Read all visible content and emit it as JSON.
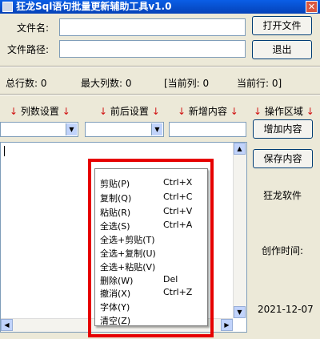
{
  "window": {
    "title": "狂龙Sql语句批量更新辅助工具v1.0",
    "close_glyph": "✕"
  },
  "file": {
    "name_label": "文件名:",
    "path_label": "文件路径:",
    "name_value": "",
    "path_value": "",
    "open_label": "打开文件",
    "exit_label": "退出"
  },
  "stats": {
    "total_rows": "总行数: 0",
    "max_cols": "最大列数: 0",
    "current_col": "[当前列: 0",
    "current_row": "当前行: 0]"
  },
  "headers": {
    "col_settings": "列数设置",
    "prefix_settings": "前后设置",
    "new_content": "新增内容",
    "operation_area": "操作区域",
    "arrow": "↓"
  },
  "combos": {
    "col_value": "",
    "prefix_value": "",
    "new_content_value": ""
  },
  "actions": {
    "add_label": "增加内容",
    "save_label": "保存内容"
  },
  "sidebar": {
    "brand": "狂龙软件",
    "created_label": "创作时间:",
    "created_date": "2021-12-07"
  },
  "context_menu": {
    "items": [
      {
        "label": "剪贴(P)",
        "shortcut": "Ctrl+X"
      },
      {
        "label": "复制(Q)",
        "shortcut": "Ctrl+C"
      },
      {
        "label": "粘贴(R)",
        "shortcut": "Ctrl+V"
      },
      {
        "label": "全选(S)",
        "shortcut": "Ctrl+A"
      },
      {
        "label": "全选+剪贴(T)",
        "shortcut": ""
      },
      {
        "label": "全选+复制(U)",
        "shortcut": ""
      },
      {
        "label": "全选+粘贴(V)",
        "shortcut": ""
      },
      {
        "label": "删除(W)",
        "shortcut": "Del"
      },
      {
        "label": "撤消(X)",
        "shortcut": "Ctrl+Z"
      },
      {
        "label": "字体(Y)",
        "shortcut": ""
      },
      {
        "label": "清空(Z)",
        "shortcut": ""
      }
    ]
  },
  "colors": {
    "title_bar": "#0a5ee6",
    "highlight_box": "#e60000",
    "window_bg": "#ece9d8"
  }
}
